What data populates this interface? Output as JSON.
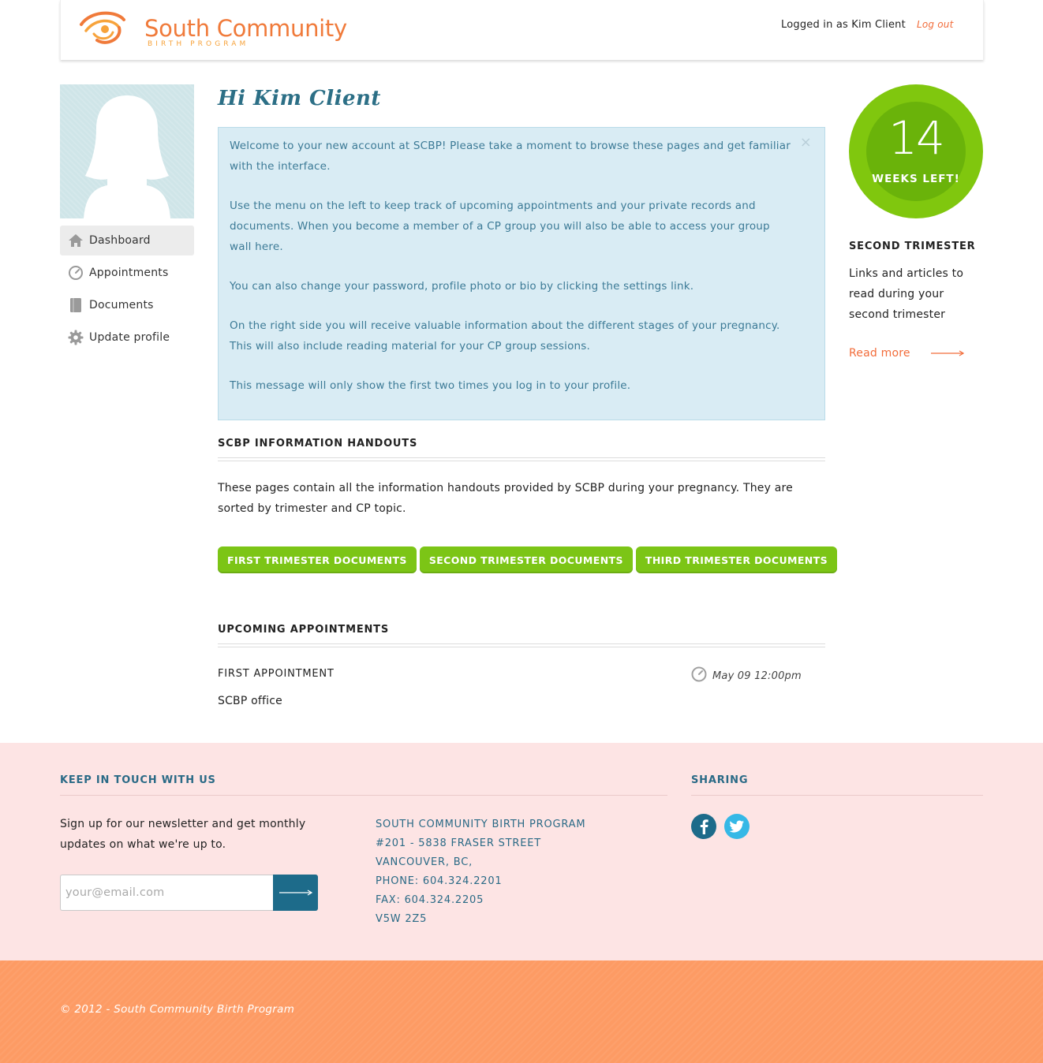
{
  "header": {
    "logo_title": "South Community",
    "logo_subtitle": "BIRTH PROGRAM",
    "logged_in_text": "Logged in as Kim Client",
    "logout_label": "Log out"
  },
  "sidebar": {
    "items": [
      {
        "label": "Dashboard",
        "icon": "home-icon",
        "active": true
      },
      {
        "label": "Appointments",
        "icon": "clock-icon",
        "active": false
      },
      {
        "label": "Documents",
        "icon": "document-icon",
        "active": false
      },
      {
        "label": "Update profile",
        "icon": "gear-icon",
        "active": false
      }
    ]
  },
  "main": {
    "greeting": "Hi Kim Client",
    "alert": {
      "close_label": "×",
      "paragraphs": [
        "Welcome to your new account at SCBP! Please take a moment to browse these pages and get familiar with the interface.",
        "Use the menu on the left to keep track of upcoming appointments and your private records and documents. When you become a member of a CP group you will also be able to access your group wall here.",
        "You can also change your password, profile photo or bio by clicking the settings link.",
        "On the right side you will receive valuable information about the different stages of your pregnancy. This will also include reading material for your CP group sessions.",
        "This message will only show the first two times you log in to your profile."
      ]
    },
    "handouts": {
      "title": "SCBP INFORMATION HANDOUTS",
      "text": "These pages contain all the information handouts provided by SCBP during your pregnancy. They are sorted by trimester and CP topic.",
      "buttons": [
        "FIRST TRIMESTER DOCUMENTS",
        "SECOND TRIMESTER DOCUMENTS",
        "THIRD TRIMESTER DOCUMENTS"
      ]
    },
    "appointments": {
      "title": "UPCOMING APPOINTMENTS",
      "items": [
        {
          "title": "FIRST APPOINTMENT",
          "time": "May 09 12:00pm",
          "location": "SCBP office"
        }
      ]
    }
  },
  "right": {
    "weeks_number": "14",
    "weeks_label": "WEEKS LEFT!",
    "trimester_title": "SECOND TRIMESTER",
    "trimester_text": "Links and articles to read during your second trimester",
    "read_more": "Read more"
  },
  "footer": {
    "keep_in_touch_title": "KEEP IN TOUCH WITH US",
    "newsletter_text": "Sign up for our newsletter and get monthly updates on what we're up to.",
    "email_placeholder": "your@email.com",
    "address_lines": [
      "SOUTH COMMUNITY BIRTH PROGRAM",
      "#201 - 5838 FRASER STREET",
      "VANCOUVER, BC,",
      "PHONE: 604.324.2201",
      "FAX: 604.324.2205",
      "V5W 2Z5"
    ],
    "sharing_title": "SHARING",
    "social": [
      "facebook-icon",
      "twitter-icon"
    ],
    "copyright": "© 2012 - South Community Birth Program"
  },
  "colors": {
    "brand_orange": "#f07a3a",
    "green": "#7cc516",
    "blue": "#2a6a86",
    "footer_pink": "#fde4e4",
    "bottom_orange": "#fd9b64"
  }
}
